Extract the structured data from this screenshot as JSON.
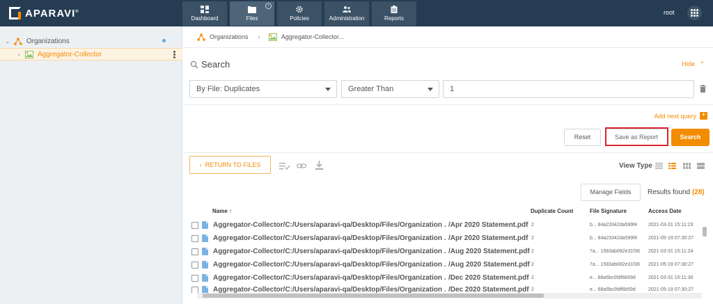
{
  "brand": {
    "name": "APARAVI",
    "mark": "®"
  },
  "nav": {
    "tabs": [
      {
        "label": "Dashboard",
        "icon": "dashboard-icon"
      },
      {
        "label": "Files",
        "icon": "folder-icon",
        "active": true,
        "info": "i"
      },
      {
        "label": "Policies",
        "icon": "gear-icon"
      },
      {
        "label": "Administration",
        "icon": "users-icon"
      },
      {
        "label": "Reports",
        "icon": "clipboard-icon"
      }
    ],
    "user": "root"
  },
  "sidebar": {
    "items": [
      {
        "label": "Organizations",
        "icon": "organization-icon",
        "expanded": true
      },
      {
        "label": "Aggregator-Collector",
        "icon": "collector-icon",
        "selected": true
      }
    ]
  },
  "breadcrumb": {
    "items": [
      "Organizations",
      "Aggregator-Collector..."
    ]
  },
  "search": {
    "title": "Search",
    "hide_label": "Hide",
    "filter_by": "By File: Duplicates",
    "operator": "Greater Than",
    "value": "1",
    "add_query_label": "Add next query",
    "reset_label": "Reset",
    "save_label": "Save as Report",
    "search_label": "Search"
  },
  "results_toolbar": {
    "return_label": "RETURN TO FILES",
    "view_type_label": "View Type",
    "manage_fields_label": "Manage Fields",
    "results_label": "Results found",
    "results_count": "(28)"
  },
  "table": {
    "columns": [
      "Name",
      "Duplicate Count",
      "File Signature",
      "Access Date"
    ],
    "sort_indicator": "↑",
    "rows": [
      {
        "path": "Aggregator-Collector/C:/Users/aparavi-qa/Desktop/Files/Organization ...",
        "file": "/Apr 2020 Statement.pdf",
        "dup": "2",
        "sig": "b... 84a23342da599f4",
        "date": "2021-03-31 15:11:23"
      },
      {
        "path": "Aggregator-Collector/C:/Users/aparavi-qa/Desktop/Files/Organization ...",
        "file": "/Apr 2020 Statement.pdf",
        "dup": "2",
        "sig": "b... 84a23342da599f4",
        "date": "2021-05-19 07:30:27"
      },
      {
        "path": "Aggregator-Collector/C:/Users/aparavi-qa/Desktop/Files/Organization ...",
        "file": "/Aug 2020 Statement.pdf",
        "dup": "2",
        "sig": "7a... 1583ab082e31f36",
        "date": "2021-03-31 15:11:24"
      },
      {
        "path": "Aggregator-Collector/C:/Users/aparavi-qa/Desktop/Files/Organization ...",
        "file": "/Aug 2020 Statement.pdf",
        "dup": "2",
        "sig": "7a... 1583ab082e31f36",
        "date": "2021-05-19 07:30:27"
      },
      {
        "path": "Aggregator-Collector/C:/Users/aparavi-qa/Desktop/Files/Organization ...",
        "file": "/Dec 2020 Statement.pdf",
        "dup": "2",
        "sig": "e... 88a5bc0fdf6b59d",
        "date": "2021-03-31 15:11:30"
      },
      {
        "path": "Aggregator-Collector/C:/Users/aparavi-qa/Desktop/Files/Organization ...",
        "file": "/Dec 2020 Statement.pdf",
        "dup": "2",
        "sig": "e... 88a5bc0fdf6b59d",
        "date": "2021-05-19 07:30:27"
      }
    ]
  },
  "colors": {
    "topbar": "#253c52",
    "accent": "#f28c00",
    "highlight_frame": "#d9232d"
  }
}
